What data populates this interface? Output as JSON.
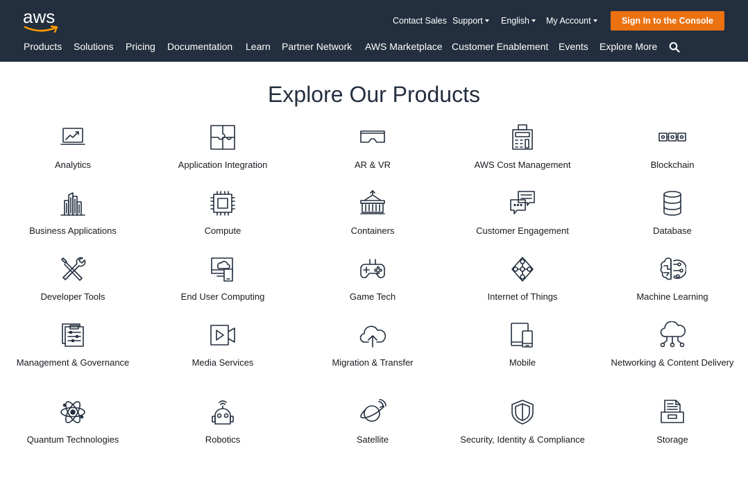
{
  "header": {
    "logo_text": "aws",
    "utility": {
      "contact_sales": "Contact Sales",
      "support": "Support",
      "language": "English",
      "my_account": "My Account"
    },
    "signin_label": "Sign In to the Console",
    "nav": [
      "Products",
      "Solutions",
      "Pricing",
      "Documentation",
      "Learn",
      "Partner Network",
      "AWS Marketplace",
      "Customer Enablement",
      "Events",
      "Explore More"
    ],
    "colors": {
      "header_bg": "#232f3e",
      "signin_bg": "#ec7211"
    }
  },
  "page_title": "Explore Our Products",
  "products": [
    {
      "label": "Analytics",
      "icon": "analytics-icon"
    },
    {
      "label": "Application Integration",
      "icon": "puzzle-icon"
    },
    {
      "label": "AR & VR",
      "icon": "vr-headset-icon"
    },
    {
      "label": "AWS Cost Management",
      "icon": "calculator-icon"
    },
    {
      "label": "Blockchain",
      "icon": "blockchain-icon"
    },
    {
      "label": "Business Applications",
      "icon": "buildings-icon"
    },
    {
      "label": "Compute",
      "icon": "chip-icon"
    },
    {
      "label": "Containers",
      "icon": "container-icon"
    },
    {
      "label": "Customer Engagement",
      "icon": "chat-bubbles-icon"
    },
    {
      "label": "Database",
      "icon": "database-icon"
    },
    {
      "label": "Developer Tools",
      "icon": "tools-icon"
    },
    {
      "label": "End User Computing",
      "icon": "desktop-cloud-icon"
    },
    {
      "label": "Game Tech",
      "icon": "gamepad-icon"
    },
    {
      "label": "Internet of Things",
      "icon": "iot-icon"
    },
    {
      "label": "Machine Learning",
      "icon": "brain-icon"
    },
    {
      "label": "Management & Governance",
      "icon": "clipboard-icon"
    },
    {
      "label": "Media Services",
      "icon": "video-icon"
    },
    {
      "label": "Migration & Transfer",
      "icon": "cloud-upload-icon"
    },
    {
      "label": "Mobile",
      "icon": "mobile-icon"
    },
    {
      "label": "Networking & Content Delivery",
      "icon": "cloud-network-icon"
    },
    {
      "label": "Quantum Technologies",
      "icon": "atom-icon"
    },
    {
      "label": "Robotics",
      "icon": "robot-icon"
    },
    {
      "label": "Satellite",
      "icon": "satellite-icon"
    },
    {
      "label": "Security, Identity & Compliance",
      "icon": "shield-icon"
    },
    {
      "label": "Storage",
      "icon": "storage-icon"
    }
  ]
}
